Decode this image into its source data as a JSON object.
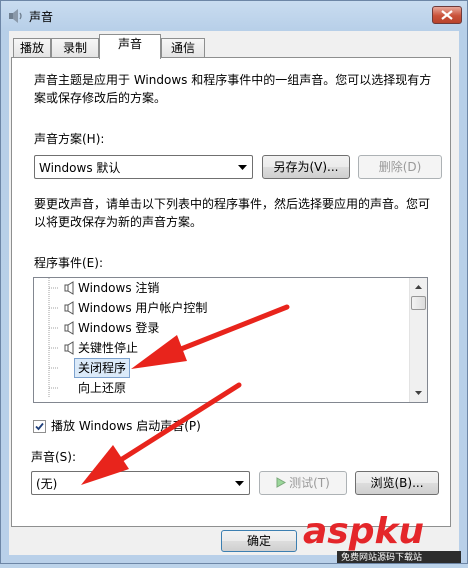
{
  "window": {
    "title": "声音"
  },
  "tabs": [
    {
      "label": "播放",
      "active": false
    },
    {
      "label": "录制",
      "active": false
    },
    {
      "label": "声音",
      "active": true
    },
    {
      "label": "通信",
      "active": false
    }
  ],
  "intro_text_line1": "声音主题是应用于 Windows 和程序事件中的一组声音。您可以选择现有方",
  "intro_text_line2": "案或保存修改后的方案。",
  "scheme": {
    "label": "声音方案(H):",
    "selected": "Windows 默认",
    "save_as_label": "另存为(V)...",
    "delete_label": "删除(D)"
  },
  "help_text_line1": "要更改声音，请单击以下列表中的程序事件，然后选择要应用的声音。您可",
  "help_text_line2": "以将更改保存为新的声音方案。",
  "events": {
    "label": "程序事件(E):",
    "items": [
      {
        "label": "Windows 注销",
        "has_sound": true,
        "selected": false
      },
      {
        "label": "Windows 用户帐户控制",
        "has_sound": true,
        "selected": false
      },
      {
        "label": "Windows 登录",
        "has_sound": true,
        "selected": false
      },
      {
        "label": "关键性停止",
        "has_sound": true,
        "selected": false
      },
      {
        "label": "关闭程序",
        "has_sound": false,
        "selected": true
      },
      {
        "label": "向上还原",
        "has_sound": false,
        "selected": false
      }
    ]
  },
  "startup_sound": {
    "label": "播放 Windows 启动声音(P)",
    "checked": true
  },
  "sound": {
    "label": "声音(S):",
    "selected": "(无)",
    "test_label": "测试(T)",
    "browse_label": "浏览(B)..."
  },
  "footer": {
    "ok_label": "确定"
  },
  "watermark": {
    "brand": "aspku",
    "tagline": "免费网站源码下载站"
  },
  "colors": {
    "annotation_arrow": "#e8241c",
    "selection_bg": "#dbeaf9"
  }
}
